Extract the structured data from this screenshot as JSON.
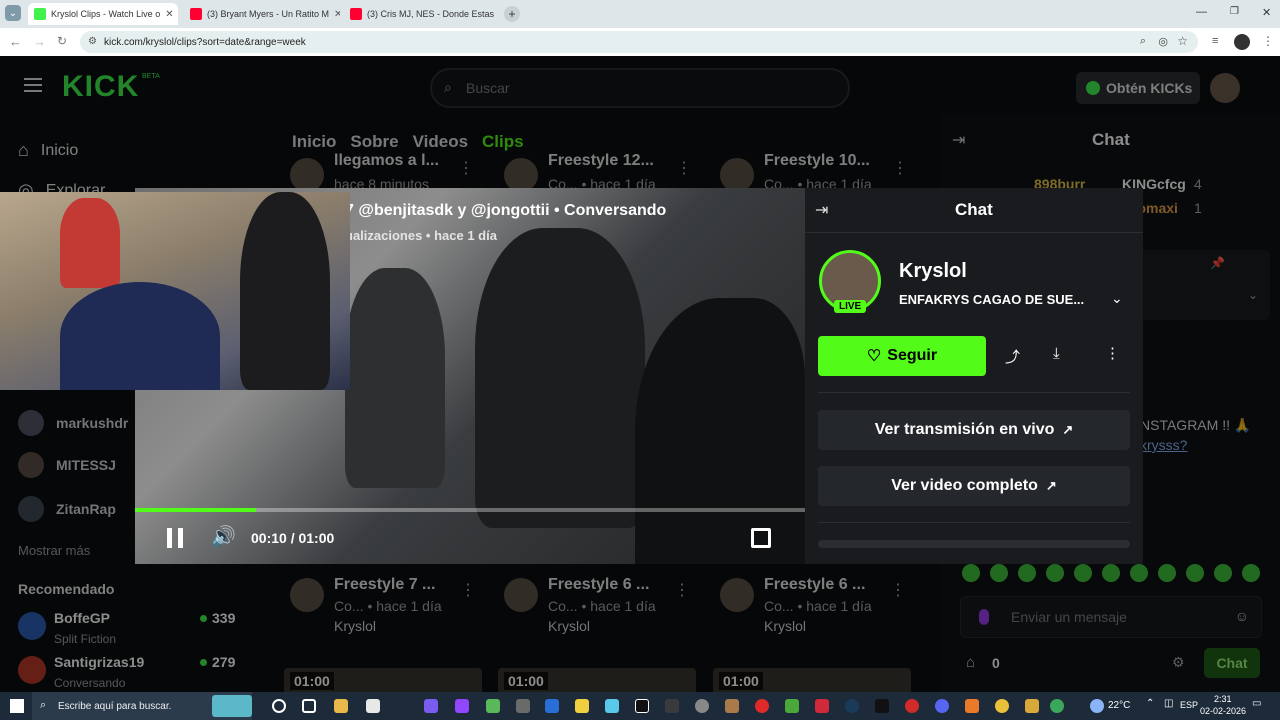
{
  "browser": {
    "tabs": [
      {
        "label": "Kryslol Clips - Watch Live o",
        "active": true,
        "color": "#41f24d"
      },
      {
        "label": "(3) Bryant Myers - Un Ratito M",
        "active": false,
        "color": "#ff0033"
      },
      {
        "label": "(3) Cris MJ, NES - Donde Estas",
        "active": false,
        "color": "#ff0033"
      }
    ],
    "url": "kick.com/kryslol/clips?sort=date&range=week"
  },
  "header": {
    "logo": "KICK",
    "logo_beta": "BETA",
    "search_placeholder": "Buscar",
    "kicks_button": "Obtén KICKs"
  },
  "sidebar": {
    "items": [
      {
        "label": "Inicio",
        "icon": "home-icon"
      },
      {
        "label": "Explorar",
        "icon": "compass-icon"
      }
    ],
    "following": [
      "markushdr",
      "MITESSJ",
      "ZitanRap"
    ],
    "show_more": "Mostrar más",
    "recommended_title": "Recomendado",
    "recommended": [
      {
        "name": "BoffeGP",
        "category": "Split Fiction",
        "viewers": "339"
      },
      {
        "name": "Santigrizas19",
        "category": "Conversando",
        "viewers": "279"
      }
    ]
  },
  "channel_tabs": [
    "Inicio",
    "Sobre",
    "Videos",
    "Clips"
  ],
  "clips_top": [
    {
      "title": "llegamos a l...",
      "meta": "hace 8 minutos"
    },
    {
      "title": "Freestyle 12...",
      "meta": "Co... • hace 1 día"
    },
    {
      "title": "Freestyle 10...",
      "meta": "Co... • hace 1 día"
    }
  ],
  "clips_bottom": [
    {
      "title": "Freestyle 7 ...",
      "meta": "Co... • hace 1 día",
      "channel": "Kryslol"
    },
    {
      "title": "Freestyle 6 ...",
      "meta": "Co... • hace 1 día",
      "channel": "Kryslol"
    },
    {
      "title": "Freestyle 6 ...",
      "meta": "Co... • hace 1 día",
      "channel": "Kryslol"
    }
  ],
  "thumb_durations": [
    "01:00",
    "01:00",
    "01:00"
  ],
  "right_chat": {
    "title": "Chat",
    "users": [
      {
        "name": "898burr",
        "color": "#e8c44a"
      },
      {
        "name": "KINGcfcg",
        "badge": "4",
        "color": "#ffffff"
      },
      {
        "name": "romaxi",
        "badge": "1",
        "color": "#e8a24a"
      }
    ],
    "partial_message": "NSTAGRAM !! 🙏",
    "partial_link": "krysss?",
    "input_placeholder": "Enviar un mensaje",
    "kicks_count": "0",
    "send_button": "Chat"
  },
  "player": {
    "title": "7 @benjitasdk y @jongottii • Conversando",
    "subtitle": "ualizaciones • hace 1 día",
    "time": "00:10 / 01:00",
    "progress": 0.18
  },
  "clip_panel": {
    "title": "Chat",
    "streamer": "Kryslol",
    "stream_title": "ENFAKRYS CAGAO DE SUE...",
    "live_badge": "LIVE",
    "follow_button": "Seguir",
    "watch_live": "Ver transmisión en vivo",
    "watch_full": "Ver video completo"
  },
  "taskbar": {
    "search_placeholder": "Escribe aquí para buscar.",
    "temperature": "22°C",
    "language": "ESP",
    "time": "2:31",
    "date": "02-02-2026"
  },
  "colors": {
    "accent": "#53fc18",
    "page_bg": "#0b0e0f",
    "panel_bg": "#191b1f"
  }
}
